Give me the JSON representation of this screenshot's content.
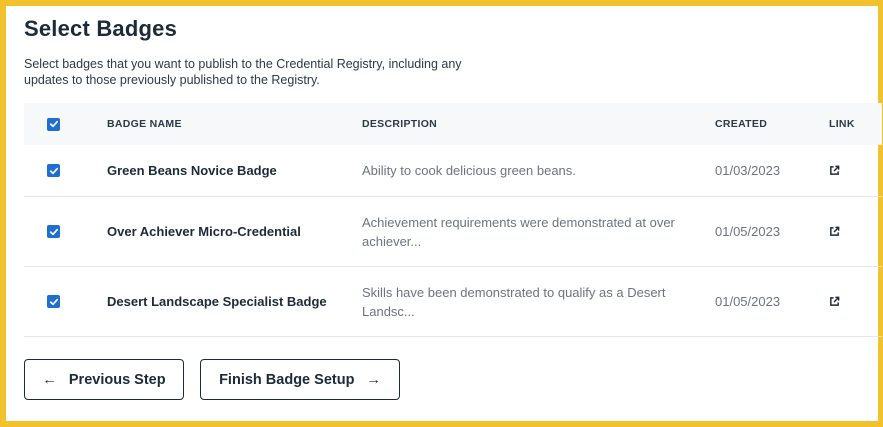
{
  "page": {
    "title": "Select Badges",
    "subtitle": "Select badges that you want to publish to the Credential Registry, including any updates to those previously published to the Registry."
  },
  "table": {
    "select_all_checked": true,
    "headers": {
      "name": "BADGE NAME",
      "description": "DESCRIPTION",
      "created": "CREATED",
      "link": "LINK"
    },
    "rows": [
      {
        "checked": true,
        "name": "Green Beans Novice Badge",
        "description": "Ability to cook delicious green beans.",
        "created": "01/03/2023",
        "link_icon": "external-link-icon"
      },
      {
        "checked": true,
        "name": "Over Achiever Micro-Credential",
        "description": "Achievement requirements were demonstrated at over achiever...",
        "created": "01/05/2023",
        "link_icon": "external-link-icon"
      },
      {
        "checked": true,
        "name": "Desert Landscape Specialist Badge",
        "description": "Skills have been demonstrated to qualify as a Desert Landsc...",
        "created": "01/05/2023",
        "link_icon": "external-link-icon"
      }
    ]
  },
  "buttons": {
    "previous": "Previous Step",
    "previous_arrow": "←",
    "finish": "Finish Badge Setup",
    "finish_arrow": "→"
  },
  "colors": {
    "frame_border": "#f2c12e",
    "checkbox": "#1f6fd1",
    "header_bg": "#f7f8fa",
    "text_dark": "#1c2b39",
    "text_muted": "#6b7480"
  }
}
